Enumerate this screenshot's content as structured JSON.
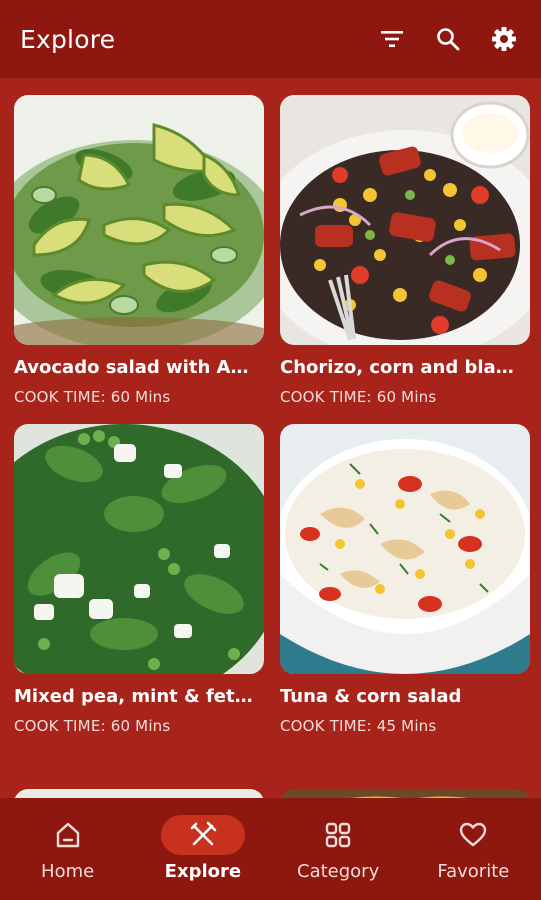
{
  "header": {
    "title": "Explore",
    "filter_icon": "filter-icon",
    "search_icon": "search-icon",
    "settings_icon": "gear-icon"
  },
  "recipes": [
    {
      "title": "Avocado salad with A…",
      "cook_time": "COOK TIME: 60 Mins"
    },
    {
      "title": "Chorizo, corn and bla…",
      "cook_time": "COOK TIME: 60 Mins"
    },
    {
      "title": "Mixed pea, mint & feta…",
      "cook_time": "COOK TIME: 60 Mins"
    },
    {
      "title": "Tuna & corn salad",
      "cook_time": "COOK TIME: 45 Mins"
    }
  ],
  "nav": {
    "items": [
      {
        "label": "Home",
        "icon": "home-icon"
      },
      {
        "label": "Explore",
        "icon": "fork-knife-icon"
      },
      {
        "label": "Category",
        "icon": "grid-icon"
      },
      {
        "label": "Favorite",
        "icon": "heart-icon"
      }
    ],
    "active": "Explore"
  },
  "colors": {
    "background": "#a8241b",
    "app_bar": "#8e170f",
    "active_pill": "#c9311f",
    "text": "#ffffff"
  }
}
